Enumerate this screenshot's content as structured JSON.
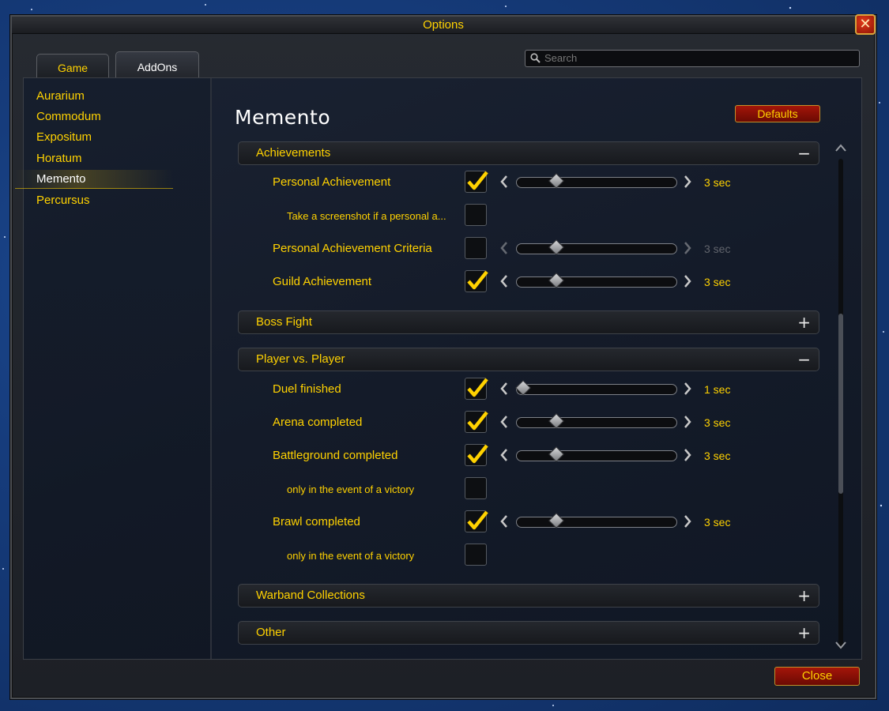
{
  "window": {
    "title": "Options",
    "close_glyph": "✕"
  },
  "tabs": [
    {
      "label": "Game",
      "active": false
    },
    {
      "label": "AddOns",
      "active": true
    }
  ],
  "search": {
    "placeholder": "Search"
  },
  "sidebar": {
    "items": [
      {
        "label": "Aurarium"
      },
      {
        "label": "Commodum"
      },
      {
        "label": "Expositum"
      },
      {
        "label": "Horatum"
      },
      {
        "label": "Memento",
        "active": true
      },
      {
        "label": "Percursus"
      }
    ]
  },
  "main": {
    "title": "Memento",
    "defaults_label": "Defaults",
    "sections": [
      {
        "label": "Achievements",
        "expanded": true,
        "toggle": "−"
      },
      {
        "label": "Boss Fight",
        "expanded": false,
        "toggle": "+"
      },
      {
        "label": "Player vs. Player",
        "expanded": true,
        "toggle": "−"
      },
      {
        "label": "Warband Collections",
        "expanded": false,
        "toggle": "+"
      },
      {
        "label": "Other",
        "expanded": false,
        "toggle": "+"
      }
    ],
    "rows": [
      {
        "label": "Personal Achievement",
        "checked": true,
        "slider": 3,
        "value": "3 sec"
      },
      {
        "label": "Take a screenshot if a personal a...",
        "checked": false,
        "sub": true
      },
      {
        "label": "Personal Achievement Criteria",
        "checked": false,
        "slider": 3,
        "value": "3 sec",
        "disabled": true
      },
      {
        "label": "Guild Achievement",
        "checked": true,
        "slider": 3,
        "value": "3 sec"
      },
      {
        "label": "Duel finished",
        "checked": true,
        "slider": 1,
        "value": "1 sec"
      },
      {
        "label": "Arena completed",
        "checked": true,
        "slider": 3,
        "value": "3 sec"
      },
      {
        "label": "Battleground completed",
        "checked": true,
        "slider": 3,
        "value": "3 sec"
      },
      {
        "label": "only in the event of a victory",
        "checked": false,
        "sub": true
      },
      {
        "label": "Brawl completed",
        "checked": true,
        "slider": 3,
        "value": "3 sec"
      },
      {
        "label": "only in the event of a victory",
        "checked": false,
        "sub": true
      }
    ],
    "slider_range": [
      1,
      10
    ]
  },
  "footer": {
    "close_label": "Close"
  },
  "colors": {
    "accent": "#ffd200",
    "button_red": "#a41509"
  }
}
